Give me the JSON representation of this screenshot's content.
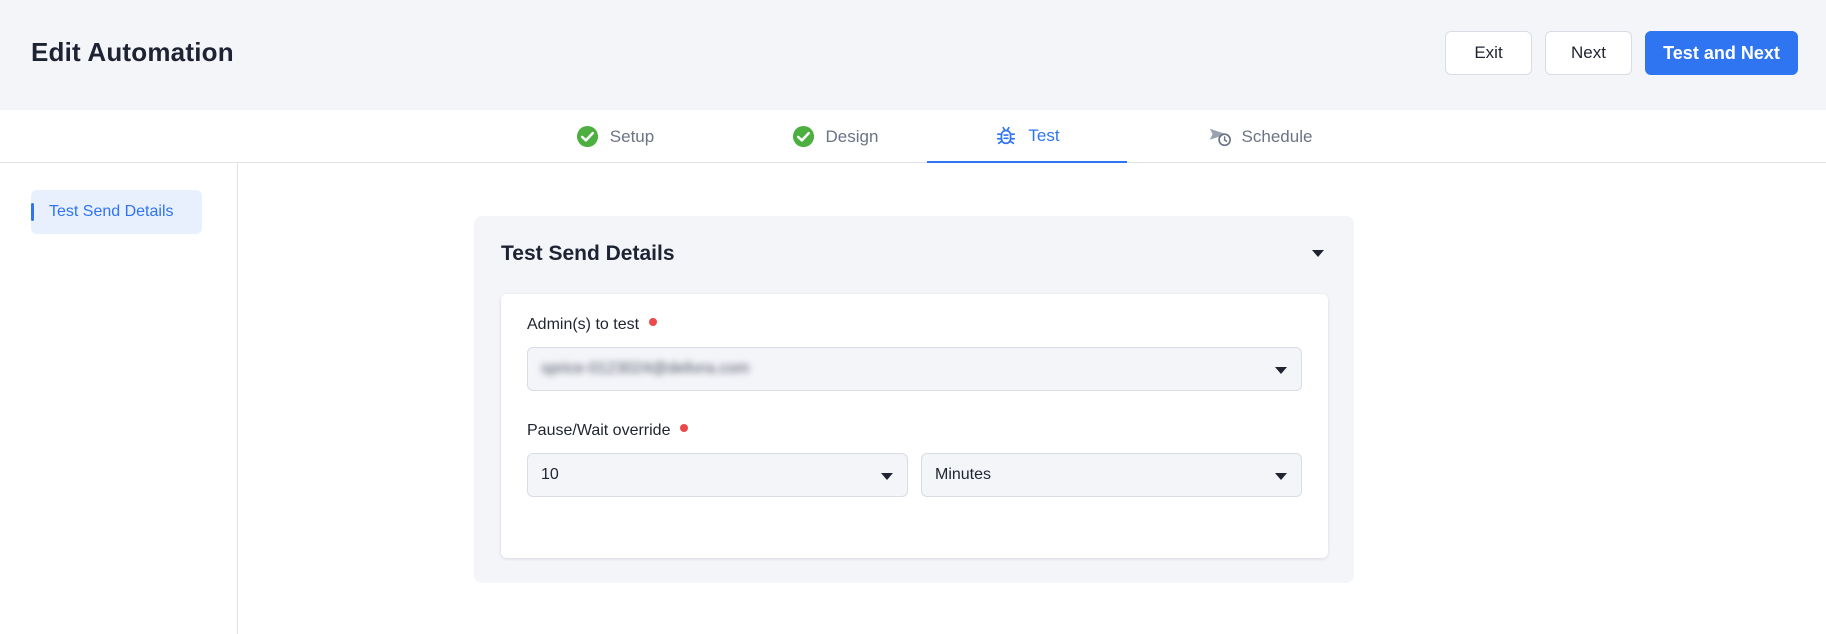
{
  "header": {
    "title": "Edit Automation",
    "exit_label": "Exit",
    "next_label": "Next",
    "test_next_label": "Test and Next"
  },
  "tabs": [
    {
      "label": "Setup",
      "icon": "check-circle-icon",
      "state": "complete"
    },
    {
      "label": "Design",
      "icon": "check-circle-icon",
      "state": "complete"
    },
    {
      "label": "Test",
      "icon": "bug-icon",
      "state": "active"
    },
    {
      "label": "Schedule",
      "icon": "send-clock-icon",
      "state": "pending"
    }
  ],
  "sidebar": {
    "items": [
      {
        "label": "Test Send Details",
        "active": true
      }
    ]
  },
  "panel": {
    "title": "Test Send Details",
    "admins_label": "Admin(s) to test",
    "admins_value": "sprice-0123024@delivra.com",
    "pause_label": "Pause/Wait override",
    "pause_value": "10",
    "pause_unit": "Minutes"
  },
  "colors": {
    "accent": "#2f74f0",
    "complete": "#4caf3f",
    "required": "#ec4a4a"
  }
}
